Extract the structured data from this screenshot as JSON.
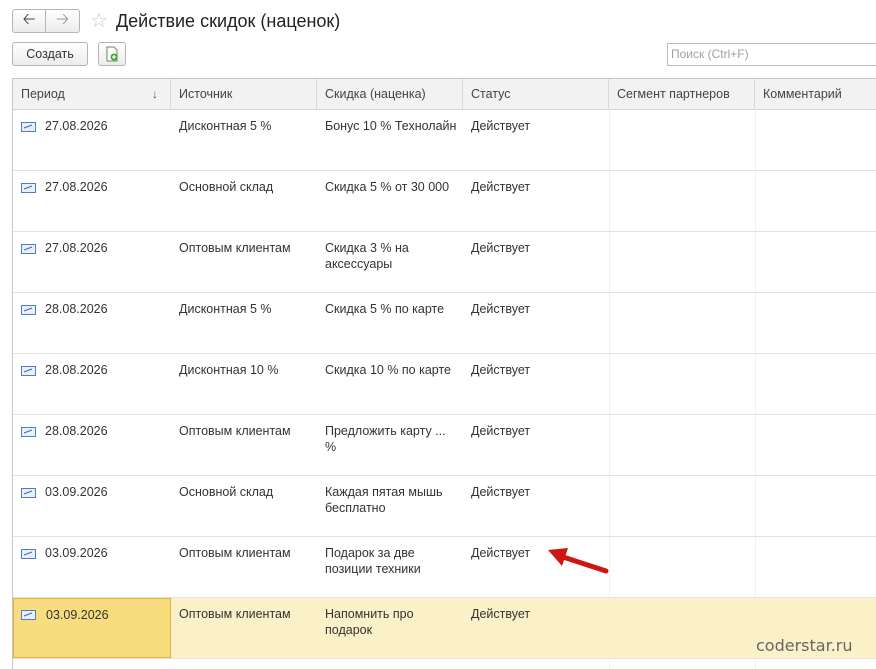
{
  "window": {
    "title": "Действие скидок (наценок)"
  },
  "toolbar": {
    "create_label": "Создать"
  },
  "search": {
    "placeholder": "Поиск (Ctrl+F)"
  },
  "table": {
    "headers": [
      "Период",
      "Источник",
      "Скидка (наценка)",
      "Статус",
      "Сегмент партнеров",
      "Комментарий"
    ],
    "sort_indicator": "↓",
    "rows": [
      {
        "period": "27.08.2026",
        "source": "Дисконтная 5 %",
        "discount": "Бонус 10 % Технолайн",
        "status": "Действует",
        "segment": "",
        "comment": ""
      },
      {
        "period": "27.08.2026",
        "source": "Основной склад",
        "discount": "Скидка 5 % от 30 000",
        "status": "Действует",
        "segment": "",
        "comment": ""
      },
      {
        "period": "27.08.2026",
        "source": "Оптовым клиентам",
        "discount": "Скидка 3 % на аксессуары",
        "status": "Действует",
        "segment": "",
        "comment": ""
      },
      {
        "period": "28.08.2026",
        "source": "Дисконтная 5 %",
        "discount": "Скидка 5 % по карте",
        "status": "Действует",
        "segment": "",
        "comment": ""
      },
      {
        "period": "28.08.2026",
        "source": "Дисконтная 10 %",
        "discount": "Скидка 10 % по карте",
        "status": "Действует",
        "segment": "",
        "comment": ""
      },
      {
        "period": "28.08.2026",
        "source": "Оптовым клиентам",
        "discount": "Предложить карту ... %",
        "status": "Действует",
        "segment": "",
        "comment": ""
      },
      {
        "period": "03.09.2026",
        "source": "Основной склад",
        "discount": "Каждая пятая мышь бесплатно",
        "status": "Действует",
        "segment": "",
        "comment": ""
      },
      {
        "period": "03.09.2026",
        "source": "Оптовым клиентам",
        "discount": "Подарок за две позиции техники",
        "status": "Действует",
        "segment": "",
        "comment": ""
      },
      {
        "period": "03.09.2026",
        "source": "Оптовым клиентам",
        "discount": "Напомнить про подарок",
        "status": "Действует",
        "segment": "",
        "comment": ""
      }
    ],
    "selected_row_index": 8
  },
  "annotation": {
    "color": "#d01515",
    "points_to_row_index": 7
  },
  "watermark": "coderstar.ru",
  "colors": {
    "selected_row": "#fbf1c8",
    "selected_cell": "#f8dd7f",
    "header_bg": "#f2f2f2"
  }
}
